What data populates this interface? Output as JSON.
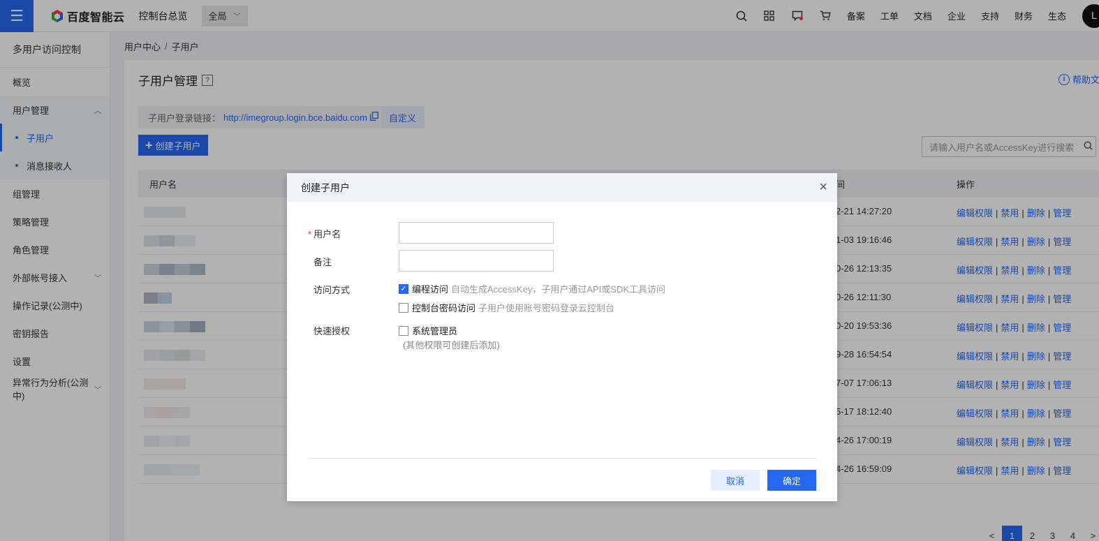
{
  "topbar": {
    "brand_name": "百度智能云",
    "console_link": "控制台总览",
    "region": "全局",
    "nav": [
      "备案",
      "工单",
      "文档",
      "企业",
      "支持",
      "财务",
      "生态"
    ],
    "avatar_letter": "L",
    "accent": "#2468f2"
  },
  "sidebar": {
    "title": "多用户访问控制",
    "items": [
      {
        "label": "概览"
      },
      {
        "label": "用户管理"
      },
      {
        "label": "子用户"
      },
      {
        "label": "消息接收人"
      },
      {
        "label": "组管理"
      },
      {
        "label": "策略管理"
      },
      {
        "label": "角色管理"
      },
      {
        "label": "外部帐号接入"
      },
      {
        "label": "操作记录(公测中)"
      },
      {
        "label": "密钥报告"
      },
      {
        "label": "设置"
      },
      {
        "label": "异常行为分析(公测中)"
      }
    ]
  },
  "breadcrumb": {
    "root": "用户中心",
    "sep": "/",
    "current": "子用户"
  },
  "page": {
    "title": "子用户管理",
    "title_help": "?",
    "help_doc": "帮助文档",
    "login_link_label": "子用户登录链接：",
    "login_link_url": "http://imegroup.login.bce.baidu.com",
    "customize_btn": "自定义",
    "create_btn": "创建子用户",
    "search_placeholder": "请输入用户名或AccessKey进行搜索"
  },
  "table": {
    "headers": {
      "username": "用户名",
      "time": "间",
      "ops": "操作"
    },
    "rows": [
      {
        "time": "2-21 14:27:20"
      },
      {
        "time": "1-03 19:16:46"
      },
      {
        "time": "0-26 12:13:35"
      },
      {
        "time": "0-26 12:11:30"
      },
      {
        "time": "0-20 19:53:36"
      },
      {
        "time": "9-28 16:54:54"
      },
      {
        "time": "7-07 17:06:13"
      },
      {
        "time": "5-17 18:12:40"
      },
      {
        "time": "4-26 17:00:19"
      },
      {
        "time": "4-26 16:59:09"
      }
    ],
    "ops": {
      "edit": "编辑权限",
      "disable": "禁用",
      "delete": "删除",
      "manage": "管理",
      "sep": "|"
    }
  },
  "pager": {
    "prev": "<",
    "pages": [
      "1",
      "2",
      "3",
      "4"
    ],
    "next": ">",
    "current": "1"
  },
  "modal": {
    "title": "创建子用户",
    "close": "×",
    "required_mark": "*",
    "username_label": "用户名",
    "remark_label": "备注",
    "access_label": "访问方式",
    "programmatic_label": "编程访问",
    "programmatic_hint": "自动生成AccessKey，子用户通过API或SDK工具访问",
    "programmatic_checked": true,
    "console_label": "控制台密码访问",
    "console_hint": "子用户使用账号密码登录云控制台",
    "console_checked": false,
    "quick_auth_label": "快速授权",
    "sysadmin_label": "系统管理员",
    "sysadmin_checked": false,
    "quick_auth_hint": "(其他权限可创建后添加)",
    "cancel": "取消",
    "ok": "确定"
  }
}
